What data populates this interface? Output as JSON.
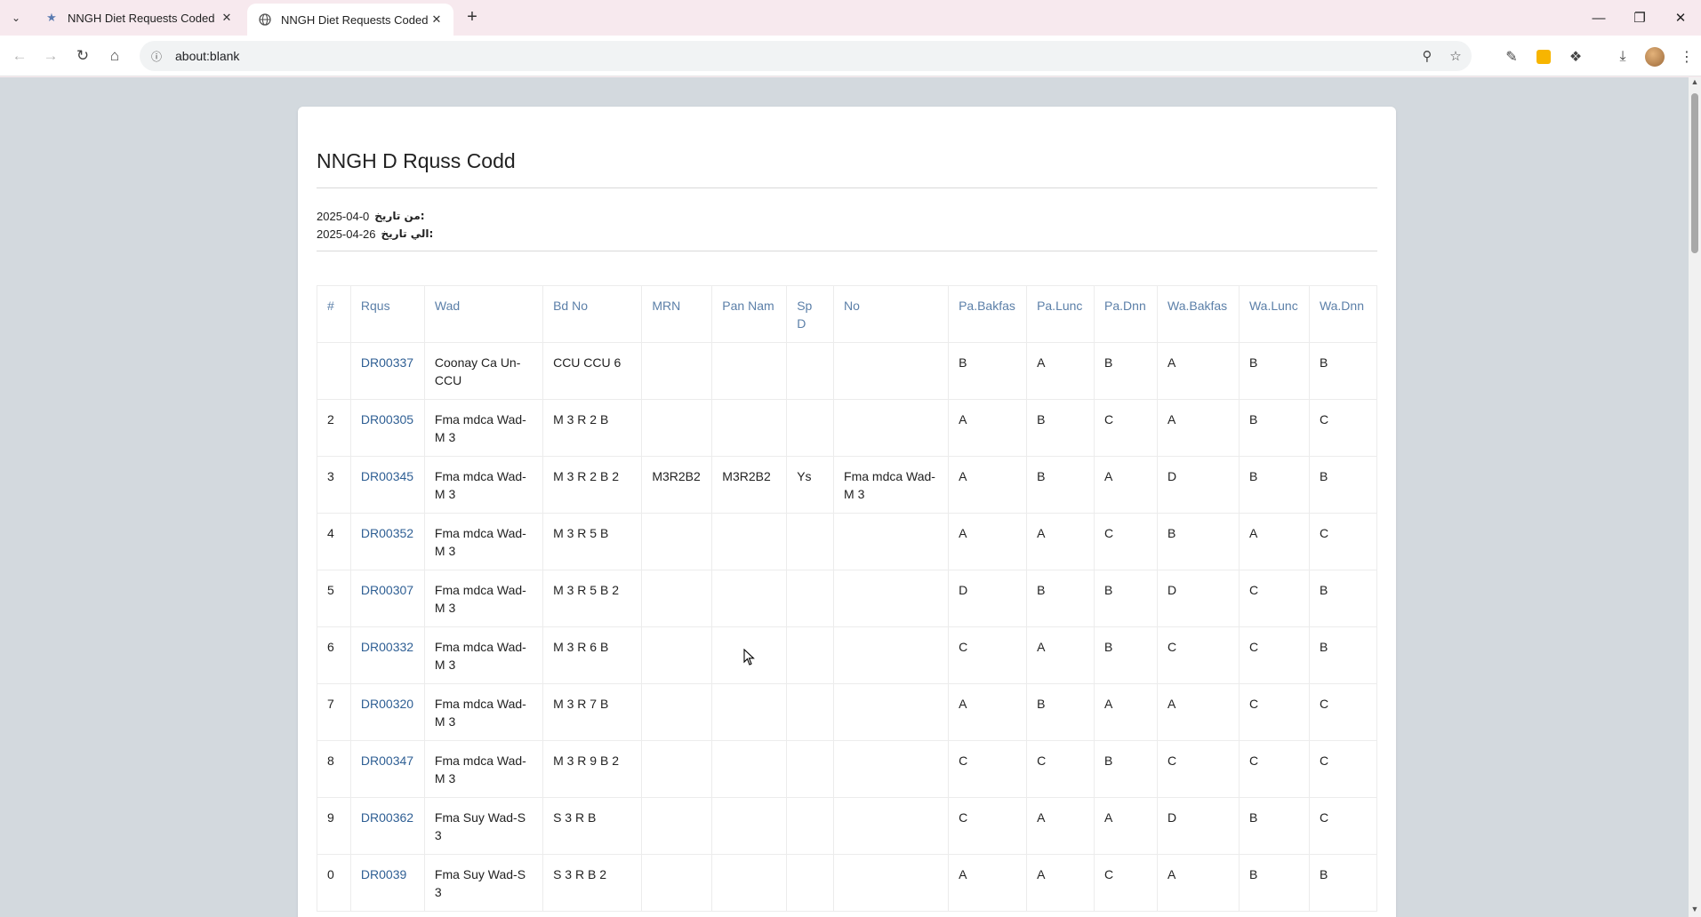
{
  "browser": {
    "tabs": [
      {
        "title": "NNGH Diet Requests Coded",
        "active": false
      },
      {
        "title": "NNGH Diet Requests Coded",
        "active": true
      }
    ],
    "url": "about:blank",
    "new_tab_symbol": "+",
    "icons": [
      "tab-search-icon",
      "back-icon",
      "forward-icon",
      "reload-icon",
      "home-icon",
      "info-icon",
      "zoom-icon",
      "star-icon",
      "pen-icon",
      "extension-icon",
      "puzzle-icon",
      "download-icon",
      "avatar",
      "more-icon"
    ]
  },
  "report": {
    "title": "NNGH D Rquss Codd",
    "from_label": "من تاريخ:",
    "from_date": "2025-04-0",
    "to_label": "الي تاريخ:",
    "to_date": "2025-04-26",
    "columns": [
      "#",
      "Rqus",
      "Wad",
      "Bd No",
      "MRN",
      "Pan Nam",
      "Sp D",
      "No",
      "Pa.Bakfas",
      "Pa.Lunc",
      "Pa.Dnn",
      "Wa.Bakfas",
      "Wa.Lunc",
      "Wa.Dnn"
    ],
    "rows": [
      {
        "num": "",
        "request": "DR00337",
        "ward": "Coonay Ca Un-CCU",
        "bed": "CCU CCU 6",
        "mrn": "",
        "patient": "",
        "sp": "",
        "note": "",
        "pb": "B",
        "pl": "A",
        "pd": "B",
        "wb": "A",
        "wl": "B",
        "wd": "B"
      },
      {
        "num": "2",
        "request": "DR00305",
        "ward": "Fma mdca Wad-M 3",
        "bed": "M 3 R 2 B",
        "mrn": "",
        "patient": "",
        "sp": "",
        "note": "",
        "pb": "A",
        "pl": "B",
        "pd": "C",
        "wb": "A",
        "wl": "B",
        "wd": "C"
      },
      {
        "num": "3",
        "request": "DR00345",
        "ward": "Fma mdca Wad-M 3",
        "bed": "M 3 R 2 B 2",
        "mrn": "M3R2B2",
        "patient": "M3R2B2",
        "sp": "Ys",
        "note": "Fma mdca Wad-M 3",
        "pb": "A",
        "pl": "B",
        "pd": "A",
        "wb": "D",
        "wl": "B",
        "wd": "B"
      },
      {
        "num": "4",
        "request": "DR00352",
        "ward": "Fma mdca Wad-M 3",
        "bed": "M 3 R 5 B",
        "mrn": "",
        "patient": "",
        "sp": "",
        "note": "",
        "pb": "A",
        "pl": "A",
        "pd": "C",
        "wb": "B",
        "wl": "A",
        "wd": "C"
      },
      {
        "num": "5",
        "request": "DR00307",
        "ward": "Fma mdca Wad-M 3",
        "bed": "M 3 R 5 B 2",
        "mrn": "",
        "patient": "",
        "sp": "",
        "note": "",
        "pb": "D",
        "pl": "B",
        "pd": "B",
        "wb": "D",
        "wl": "C",
        "wd": "B"
      },
      {
        "num": "6",
        "request": "DR00332",
        "ward": "Fma mdca Wad-M 3",
        "bed": "M 3 R 6 B",
        "mrn": "",
        "patient": "",
        "sp": "",
        "note": "",
        "pb": "C",
        "pl": "A",
        "pd": "B",
        "wb": "C",
        "wl": "C",
        "wd": "B"
      },
      {
        "num": "7",
        "request": "DR00320",
        "ward": "Fma mdca Wad-M 3",
        "bed": "M 3 R 7 B",
        "mrn": "",
        "patient": "",
        "sp": "",
        "note": "",
        "pb": "A",
        "pl": "B",
        "pd": "A",
        "wb": "A",
        "wl": "C",
        "wd": "C"
      },
      {
        "num": "8",
        "request": "DR00347",
        "ward": "Fma mdca Wad-M 3",
        "bed": "M 3 R 9 B 2",
        "mrn": "",
        "patient": "",
        "sp": "",
        "note": "",
        "pb": "C",
        "pl": "C",
        "pd": "B",
        "wb": "C",
        "wl": "C",
        "wd": "C"
      },
      {
        "num": "9",
        "request": "DR00362",
        "ward": "Fma Suy Wad-S 3",
        "bed": "S 3 R  B",
        "mrn": "",
        "patient": "",
        "sp": "",
        "note": "",
        "pb": "C",
        "pl": "A",
        "pd": "A",
        "wb": "D",
        "wl": "B",
        "wd": "C"
      },
      {
        "num": "0",
        "request": "DR0039",
        "ward": "Fma Suy Wad-S 3",
        "bed": "S 3 R  B 2",
        "mrn": "",
        "patient": "",
        "sp": "",
        "note": "",
        "pb": "A",
        "pl": "A",
        "pd": "C",
        "wb": "A",
        "wl": "B",
        "wd": "B"
      }
    ]
  },
  "colors": {
    "header_text": "#5b7fa8",
    "request_link": "#2f5f94",
    "page_bg": "#d3d9de",
    "chrome_bg": "#f7e9ee"
  }
}
